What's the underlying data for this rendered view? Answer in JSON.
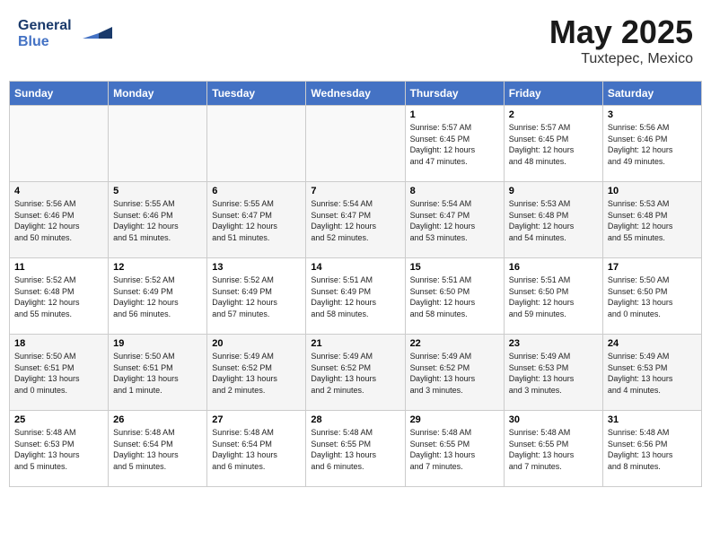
{
  "logo": {
    "line1": "General",
    "line2": "Blue"
  },
  "title": "May 2025",
  "subtitle": "Tuxtepec, Mexico",
  "weekdays": [
    "Sunday",
    "Monday",
    "Tuesday",
    "Wednesday",
    "Thursday",
    "Friday",
    "Saturday"
  ],
  "weeks": [
    [
      {
        "day": "",
        "detail": ""
      },
      {
        "day": "",
        "detail": ""
      },
      {
        "day": "",
        "detail": ""
      },
      {
        "day": "",
        "detail": ""
      },
      {
        "day": "1",
        "detail": "Sunrise: 5:57 AM\nSunset: 6:45 PM\nDaylight: 12 hours\nand 47 minutes."
      },
      {
        "day": "2",
        "detail": "Sunrise: 5:57 AM\nSunset: 6:45 PM\nDaylight: 12 hours\nand 48 minutes."
      },
      {
        "day": "3",
        "detail": "Sunrise: 5:56 AM\nSunset: 6:46 PM\nDaylight: 12 hours\nand 49 minutes."
      }
    ],
    [
      {
        "day": "4",
        "detail": "Sunrise: 5:56 AM\nSunset: 6:46 PM\nDaylight: 12 hours\nand 50 minutes."
      },
      {
        "day": "5",
        "detail": "Sunrise: 5:55 AM\nSunset: 6:46 PM\nDaylight: 12 hours\nand 51 minutes."
      },
      {
        "day": "6",
        "detail": "Sunrise: 5:55 AM\nSunset: 6:47 PM\nDaylight: 12 hours\nand 51 minutes."
      },
      {
        "day": "7",
        "detail": "Sunrise: 5:54 AM\nSunset: 6:47 PM\nDaylight: 12 hours\nand 52 minutes."
      },
      {
        "day": "8",
        "detail": "Sunrise: 5:54 AM\nSunset: 6:47 PM\nDaylight: 12 hours\nand 53 minutes."
      },
      {
        "day": "9",
        "detail": "Sunrise: 5:53 AM\nSunset: 6:48 PM\nDaylight: 12 hours\nand 54 minutes."
      },
      {
        "day": "10",
        "detail": "Sunrise: 5:53 AM\nSunset: 6:48 PM\nDaylight: 12 hours\nand 55 minutes."
      }
    ],
    [
      {
        "day": "11",
        "detail": "Sunrise: 5:52 AM\nSunset: 6:48 PM\nDaylight: 12 hours\nand 55 minutes."
      },
      {
        "day": "12",
        "detail": "Sunrise: 5:52 AM\nSunset: 6:49 PM\nDaylight: 12 hours\nand 56 minutes."
      },
      {
        "day": "13",
        "detail": "Sunrise: 5:52 AM\nSunset: 6:49 PM\nDaylight: 12 hours\nand 57 minutes."
      },
      {
        "day": "14",
        "detail": "Sunrise: 5:51 AM\nSunset: 6:49 PM\nDaylight: 12 hours\nand 58 minutes."
      },
      {
        "day": "15",
        "detail": "Sunrise: 5:51 AM\nSunset: 6:50 PM\nDaylight: 12 hours\nand 58 minutes."
      },
      {
        "day": "16",
        "detail": "Sunrise: 5:51 AM\nSunset: 6:50 PM\nDaylight: 12 hours\nand 59 minutes."
      },
      {
        "day": "17",
        "detail": "Sunrise: 5:50 AM\nSunset: 6:50 PM\nDaylight: 13 hours\nand 0 minutes."
      }
    ],
    [
      {
        "day": "18",
        "detail": "Sunrise: 5:50 AM\nSunset: 6:51 PM\nDaylight: 13 hours\nand 0 minutes."
      },
      {
        "day": "19",
        "detail": "Sunrise: 5:50 AM\nSunset: 6:51 PM\nDaylight: 13 hours\nand 1 minute."
      },
      {
        "day": "20",
        "detail": "Sunrise: 5:49 AM\nSunset: 6:52 PM\nDaylight: 13 hours\nand 2 minutes."
      },
      {
        "day": "21",
        "detail": "Sunrise: 5:49 AM\nSunset: 6:52 PM\nDaylight: 13 hours\nand 2 minutes."
      },
      {
        "day": "22",
        "detail": "Sunrise: 5:49 AM\nSunset: 6:52 PM\nDaylight: 13 hours\nand 3 minutes."
      },
      {
        "day": "23",
        "detail": "Sunrise: 5:49 AM\nSunset: 6:53 PM\nDaylight: 13 hours\nand 3 minutes."
      },
      {
        "day": "24",
        "detail": "Sunrise: 5:49 AM\nSunset: 6:53 PM\nDaylight: 13 hours\nand 4 minutes."
      }
    ],
    [
      {
        "day": "25",
        "detail": "Sunrise: 5:48 AM\nSunset: 6:53 PM\nDaylight: 13 hours\nand 5 minutes."
      },
      {
        "day": "26",
        "detail": "Sunrise: 5:48 AM\nSunset: 6:54 PM\nDaylight: 13 hours\nand 5 minutes."
      },
      {
        "day": "27",
        "detail": "Sunrise: 5:48 AM\nSunset: 6:54 PM\nDaylight: 13 hours\nand 6 minutes."
      },
      {
        "day": "28",
        "detail": "Sunrise: 5:48 AM\nSunset: 6:55 PM\nDaylight: 13 hours\nand 6 minutes."
      },
      {
        "day": "29",
        "detail": "Sunrise: 5:48 AM\nSunset: 6:55 PM\nDaylight: 13 hours\nand 7 minutes."
      },
      {
        "day": "30",
        "detail": "Sunrise: 5:48 AM\nSunset: 6:55 PM\nDaylight: 13 hours\nand 7 minutes."
      },
      {
        "day": "31",
        "detail": "Sunrise: 5:48 AM\nSunset: 6:56 PM\nDaylight: 13 hours\nand 8 minutes."
      }
    ]
  ]
}
